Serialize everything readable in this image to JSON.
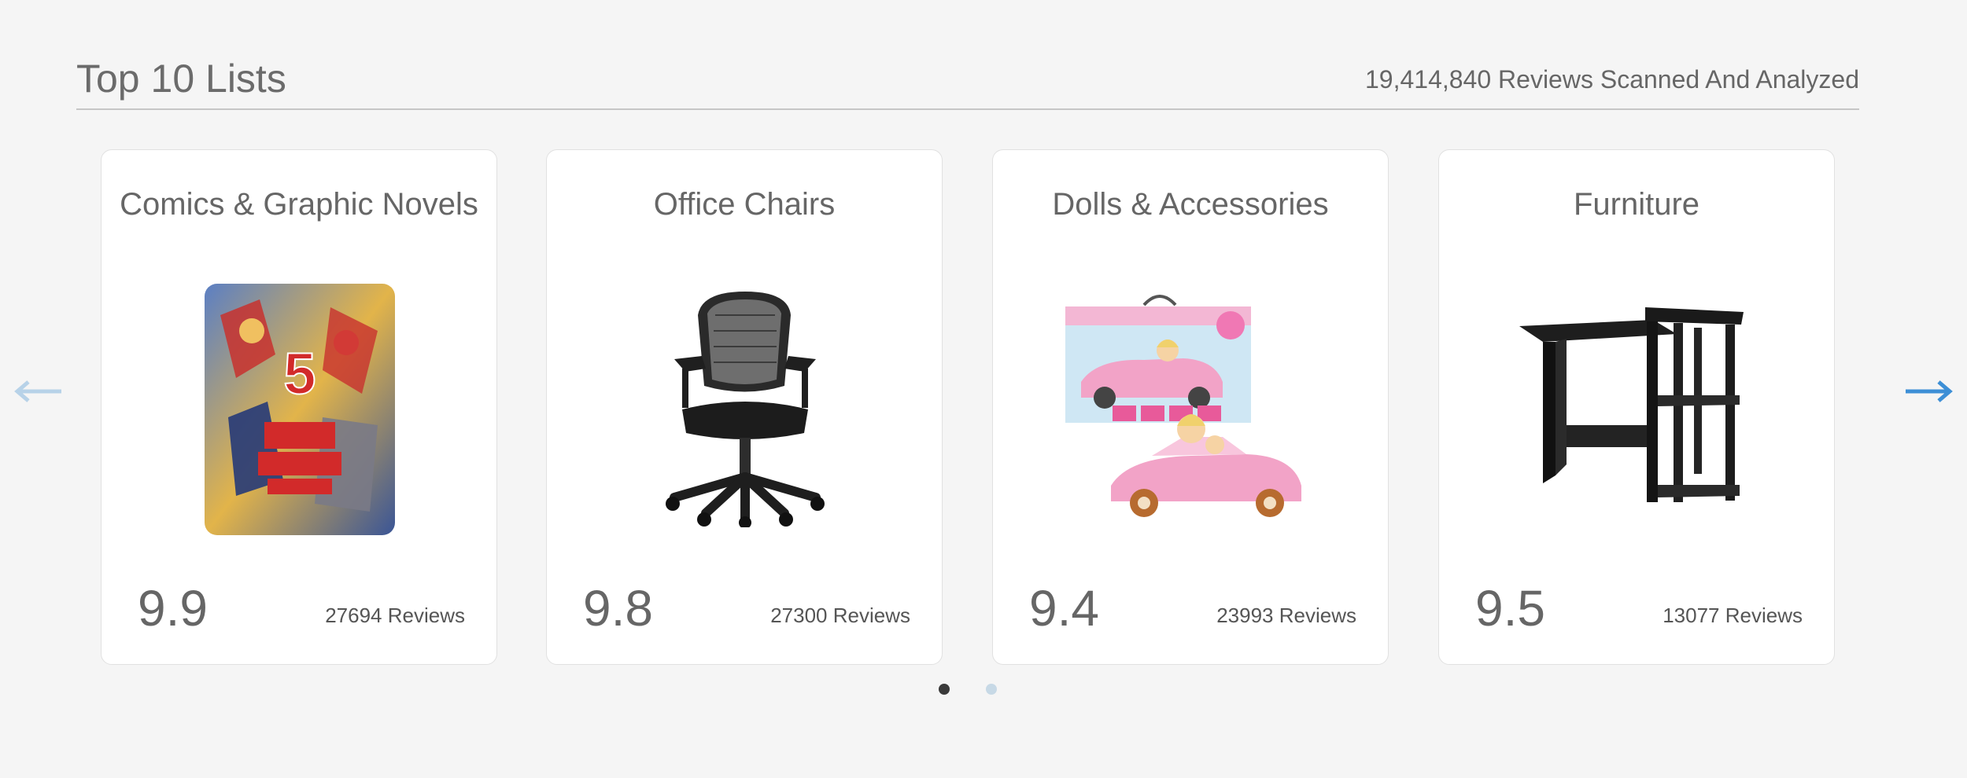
{
  "header": {
    "title": "Top 10 Lists",
    "meta": "19,414,840 Reviews Scanned And Analyzed"
  },
  "carousel": {
    "prev_icon": "arrow-left-icon",
    "next_icon": "arrow-right-icon",
    "prev_color": "#b7d2e8",
    "next_color": "#3d8fd6",
    "active_page": 1,
    "page_count": 2
  },
  "cards": [
    {
      "title": "Comics & Graphic Novels",
      "score": "9.9",
      "reviews": "27694 Reviews",
      "image": "comic-book-cover-image"
    },
    {
      "title": "Office Chairs",
      "score": "9.8",
      "reviews": "27300 Reviews",
      "image": "office-chair-image"
    },
    {
      "title": "Dolls & Accessories",
      "score": "9.4",
      "reviews": "23993 Reviews",
      "image": "doll-car-set-image"
    },
    {
      "title": "Furniture",
      "score": "9.5",
      "reviews": "13077 Reviews",
      "image": "desk-with-shelves-image"
    }
  ]
}
